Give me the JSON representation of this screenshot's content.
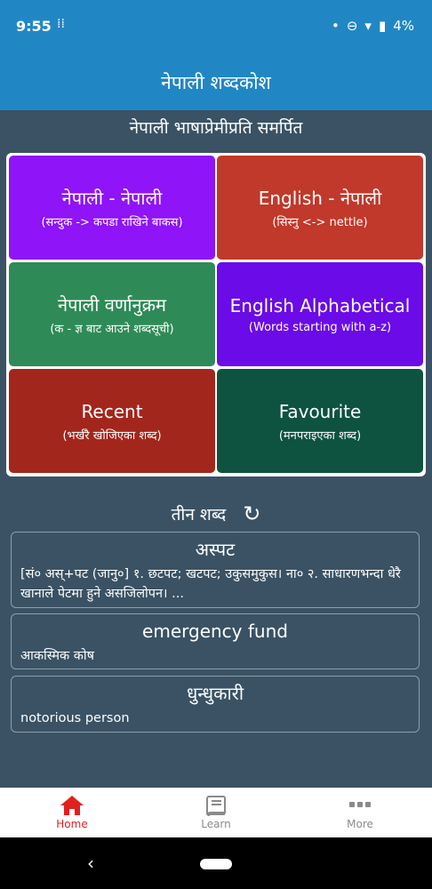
{
  "status_bar": {
    "time": "9:55",
    "grid_glyph": "⁞⁞",
    "dot": "•",
    "dnd_glyph": "⊖",
    "wifi_glyph": "▾",
    "battery_glyph": "▮",
    "battery": "4%"
  },
  "app": {
    "title": "नेपाली शब्दकोश",
    "dedication": "नेपाली भाषाप्रेमीप्रति समर्पित"
  },
  "tiles": [
    {
      "title": "नेपाली - नेपाली",
      "subtitle": "(सन्दुक -> कपडा राखिने बाकस)",
      "color": "#8f14f7"
    },
    {
      "title": "English - नेपाली",
      "subtitle": "(सिस्नु <-> nettle)",
      "color": "#c0392b"
    },
    {
      "title": "नेपाली वर्णानुक्रम",
      "subtitle": "(क - ज्ञ बाट आउने शब्दसूची)",
      "color": "#2e8b57"
    },
    {
      "title": "English Alphabetical",
      "subtitle": "(Words starting with a-z)",
      "color": "#6a0be8"
    },
    {
      "title": "Recent",
      "subtitle": "(भर्खरै खोजिएका शब्द)",
      "color": "#a3261c"
    },
    {
      "title": "Favourite",
      "subtitle": "(मनपराइएका शब्द)",
      "color": "#0d5340"
    }
  ],
  "three_words": {
    "title": "तीन शब्द",
    "refresh_glyph": "↻",
    "cards": [
      {
        "word": "अस्पट",
        "definition": "[सं० अस्+पट (जानु०] १. छटपट; खटपट; उकुसमुकुस। ना० २. साधारणभन्दा धेरै खानाले पेटमा हुने असजिलोपन। ..."
      },
      {
        "word": "emergency fund",
        "definition": "आकस्मिक कोष"
      },
      {
        "word": "धुन्धुकारी",
        "definition": "notorious person"
      }
    ]
  },
  "nav": {
    "home": "Home",
    "learn": "Learn",
    "more": "More",
    "active_color": "#e0201c",
    "inactive_color": "#8a8a8a"
  },
  "system_nav": {
    "back_glyph": "‹"
  }
}
